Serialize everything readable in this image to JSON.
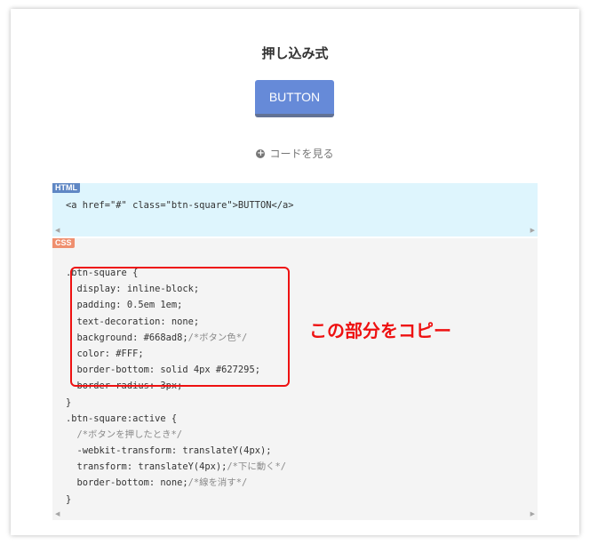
{
  "section_title": "押し込み式",
  "demo_button_label": "BUTTON",
  "code_toggle_label": "コードを見る",
  "html_block": {
    "tag": "HTML",
    "code": "<a href=\"#\" class=\"btn-square\">BUTTON</a>"
  },
  "css_block": {
    "tag": "CSS",
    "lines": [
      {
        "code": ".btn-square {",
        "comment": ""
      },
      {
        "code": "  display: inline-block;",
        "comment": ""
      },
      {
        "code": "  padding: 0.5em 1em;",
        "comment": ""
      },
      {
        "code": "  text-decoration: none;",
        "comment": ""
      },
      {
        "code": "  background: #668ad8;",
        "comment": "/*ボタン色*/"
      },
      {
        "code": "  color: #FFF;",
        "comment": ""
      },
      {
        "code": "  border-bottom: solid 4px #627295;",
        "comment": ""
      },
      {
        "code": "  border-radius: 3px;",
        "comment": ""
      },
      {
        "code": "}",
        "comment": ""
      },
      {
        "code": ".btn-square:active {",
        "comment": ""
      },
      {
        "code": "  ",
        "comment": "/*ボタンを押したとき*/"
      },
      {
        "code": "  -webkit-transform: translateY(4px);",
        "comment": ""
      },
      {
        "code": "  transform: translateY(4px);",
        "comment": "/*下に動く*/"
      },
      {
        "code": "  border-bottom: none;",
        "comment": "/*線を消す*/"
      },
      {
        "code": "}",
        "comment": ""
      }
    ]
  },
  "annotation": "この部分をコピー",
  "colors": {
    "button_bg": "#668ad8",
    "button_border": "#627295",
    "highlight_red": "#ee1111",
    "html_panel_bg": "#def5fd",
    "css_panel_bg": "#f4f4f4"
  }
}
